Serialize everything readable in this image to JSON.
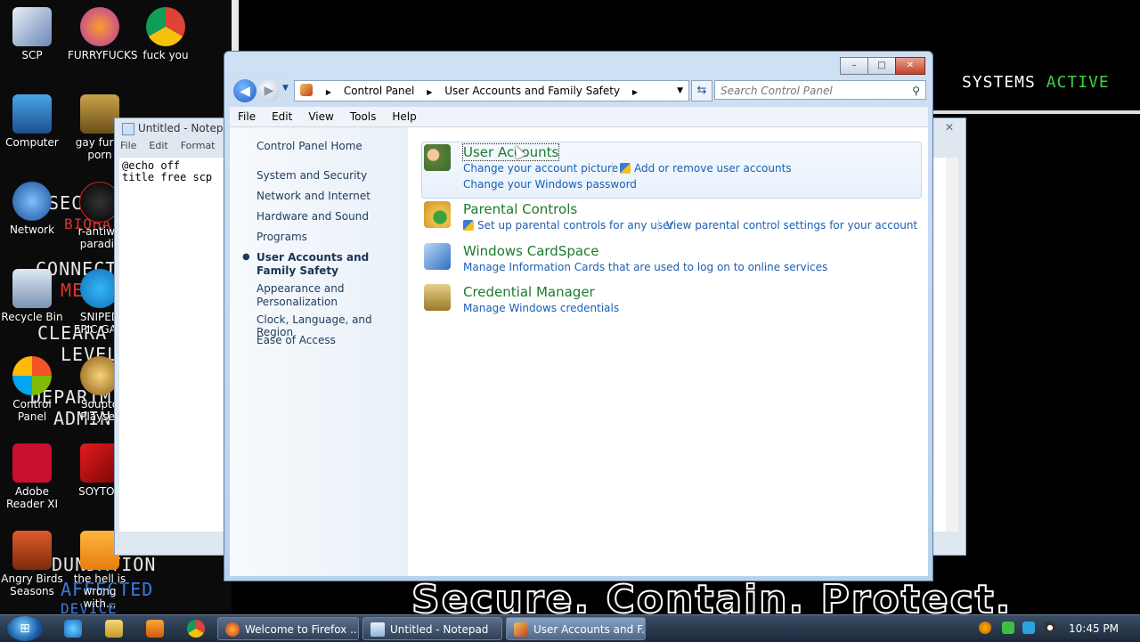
{
  "desktop": {
    "icons": [
      {
        "label": "SCP"
      },
      {
        "label": "FURRYFUCKS"
      },
      {
        "label": "fuck you"
      },
      {
        "label": "Computer"
      },
      {
        "label": "gay furry porn"
      },
      {
        "label": "Network"
      },
      {
        "label": "r-antiwo paradis"
      },
      {
        "label": "Recycle Bin"
      },
      {
        "label": "SNIPED EPIC GAM"
      },
      {
        "label": "Control Panel"
      },
      {
        "label": "Soupto Playser"
      },
      {
        "label": "Adobe Reader XI"
      },
      {
        "label": "SOYTOT"
      },
      {
        "label": "Angry Birds Seasons"
      },
      {
        "label": "the hell is wrong with..."
      }
    ],
    "wallpaper_text": [
      "SECU",
      "BIOHA",
      "CONNECT",
      "ME",
      "CLEARA",
      "LEVEL",
      "DEPARTM",
      "ADMIN",
      "DUNDATION",
      "AFFECTED",
      "DEVICE"
    ],
    "systems_label": "SYSTEMS",
    "systems_status": "ACTIVE",
    "slogan": "Secure. Contain. Protect."
  },
  "notepad": {
    "title": "Untitled - Notepad",
    "menu": [
      "File",
      "Edit",
      "Format"
    ],
    "content": "@echo off\ntitle free scp"
  },
  "window": {
    "caption_buttons": {
      "minimize": "–",
      "maximize": "□",
      "close": "✕"
    },
    "address": {
      "crumbs": [
        "Control Panel",
        "User Accounts and Family Safety"
      ]
    },
    "search_placeholder": "Search Control Panel",
    "menu": [
      "File",
      "Edit",
      "View",
      "Tools",
      "Help"
    ],
    "left_nav": [
      {
        "label": "Control Panel Home"
      },
      {
        "label": "System and Security"
      },
      {
        "label": "Network and Internet"
      },
      {
        "label": "Hardware and Sound"
      },
      {
        "label": "Programs"
      },
      {
        "label": "User Accounts and Family Safety",
        "current": true
      },
      {
        "label": "Appearance and Personalization"
      },
      {
        "label": "Clock, Language, and Region"
      },
      {
        "label": "Ease of Access"
      }
    ],
    "categories": [
      {
        "title": "User Accounts",
        "links": [
          "Change your account picture",
          "Add or remove user accounts",
          "Change your Windows password"
        ]
      },
      {
        "title": "Parental Controls",
        "links": [
          "Set up parental controls for any user",
          "View parental control settings for your account"
        ]
      },
      {
        "title": "Windows CardSpace",
        "links": [
          "Manage Information Cards that are used to log on to online services"
        ]
      },
      {
        "title": "Credential Manager",
        "links": [
          "Manage Windows credentials"
        ]
      }
    ]
  },
  "taskbar": {
    "buttons": [
      {
        "label": "Welcome to Firefox ..."
      },
      {
        "label": "Untitled - Notepad"
      },
      {
        "label": "User Accounts and F..."
      }
    ],
    "clock": "10:45 PM"
  }
}
